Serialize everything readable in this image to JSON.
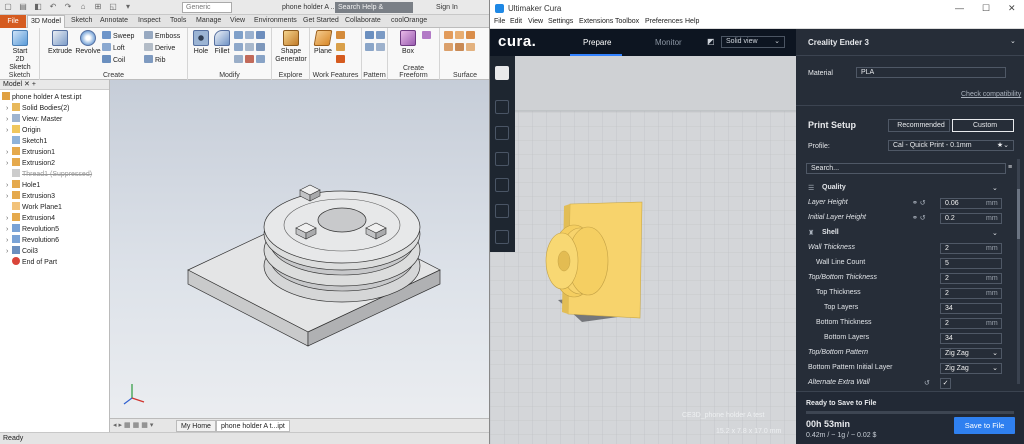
{
  "inventor": {
    "quick_access_glyphs": [
      "▢",
      "▤",
      "◧",
      "↶",
      "↷",
      "⌂",
      "⊞",
      "◱",
      "▾"
    ],
    "generic": "Generic",
    "doc_title": "phone holder A ...",
    "help_search": "Search Help & Commands...",
    "sign_in": "Sign In",
    "tabs": [
      "File",
      "3D Model",
      "Sketch",
      "Annotate",
      "Inspect",
      "Tools",
      "Manage",
      "View",
      "Environments",
      "Get Started",
      "Collaborate",
      "coolOrange"
    ],
    "ribbon": {
      "start_sketch_1": "Start",
      "start_sketch_2": "2D Sketch",
      "sketch_group": "Sketch",
      "extrude": "Extrude",
      "revolve": "Revolve",
      "sweep": "Sweep",
      "loft": "Loft",
      "coil": "Coil",
      "emboss": "Emboss",
      "derive": "Derive",
      "rib": "Rib",
      "create_group": "Create",
      "hole": "Hole",
      "fillet": "Fillet",
      "modify_group": "Modify",
      "shape_generator_1": "Shape",
      "shape_generator_2": "Generator",
      "explore_group": "Explore",
      "plane": "Plane",
      "work_features_group": "Work Features",
      "pattern_group": "Pattern",
      "box": "Box",
      "create_freeform_group": "Create Freeform",
      "surface_group": "Surface"
    },
    "browser_header": "Model",
    "tree": [
      "phone holder A test.ipt",
      "Solid Bodies(2)",
      "View: Master",
      "Origin",
      "Sketch1",
      "Extrusion1",
      "Extrusion2",
      "Thread1 (Suppressed)",
      "Hole1",
      "Extrusion3",
      "Work Plane1",
      "Extrusion4",
      "Revolution5",
      "Revolution6",
      "Coil3",
      "End of Part"
    ],
    "bottom_tabs": [
      "My Home",
      "phone holder A t...ipt"
    ],
    "status": "Ready"
  },
  "cura": {
    "window_title": "Ultimaker Cura",
    "menu": [
      "File",
      "Edit",
      "View",
      "Settings",
      "Extensions",
      "Toolbox",
      "Preferences",
      "Help"
    ],
    "brand": "cura.",
    "stage_prepare": "Prepare",
    "stage_monitor": "Monitor",
    "view_mode": "Solid view",
    "printer": "Creality Ender 3",
    "material_label": "Material",
    "material_value": "PLA",
    "check_compat": "Check compatibility",
    "print_setup": "Print Setup",
    "recommended": "Recommended",
    "custom": "Custom",
    "profile_label": "Profile:",
    "profile_value": "Cal - Quick Print - 0.1mm",
    "search_placeholder": "Search...",
    "quality": "Quality",
    "layer_height": "Layer Height",
    "layer_height_val": "0.06",
    "initial_layer_height": "Initial Layer Height",
    "initial_layer_height_val": "0.2",
    "shell": "Shell",
    "wall_thickness": "Wall Thickness",
    "wall_thickness_val": "2",
    "wall_line_count": "Wall Line Count",
    "wall_line_count_val": "5",
    "tb_thickness": "Top/Bottom Thickness",
    "tb_thickness_val": "2",
    "top_thickness": "Top Thickness",
    "top_thickness_val": "2",
    "top_layers": "Top Layers",
    "top_layers_val": "34",
    "bottom_thickness": "Bottom Thickness",
    "bottom_thickness_val": "2",
    "bottom_layers": "Bottom Layers",
    "bottom_layers_val": "34",
    "tb_pattern": "Top/Bottom Pattern",
    "tb_pattern_val": "Zig Zag",
    "bottom_pattern_initial": "Bottom Pattern Initial Layer",
    "bottom_pattern_initial_val": "Zig Zag",
    "alternate_extra_wall": "Alternate Extra Wall",
    "unit_mm": "mm",
    "model_name": "CE3D_phone holder A test",
    "model_dims": "15.2 x 7.8 x 17.0 mm",
    "ready": "Ready to Save to File",
    "time": "00h 53min",
    "estimate": "0.42m / ~ 1g / ~ 0.02 $",
    "save": "Save to File",
    "colors": {
      "model": "#f7d36c",
      "accent": "#2f80f0",
      "panel": "#262d38",
      "topbar": "#0d1521"
    }
  }
}
